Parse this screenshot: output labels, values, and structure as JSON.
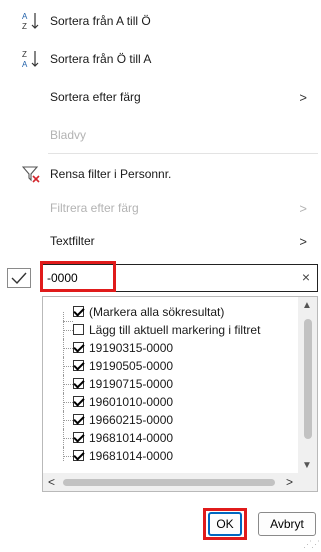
{
  "menu": {
    "sort_asc": "Sortera från A till Ö",
    "sort_desc": "Sortera från Ö till A",
    "sort_by_color": "Sortera efter färg",
    "sheet_view": "Bladvy",
    "clear_filter": "Rensa filter i Personnr.",
    "filter_by_color": "Filtrera efter färg",
    "text_filter": "Textfilter"
  },
  "search": {
    "value": "-0000",
    "clear_glyph": "×"
  },
  "list": {
    "select_all": "(Markera alla sökresultat)",
    "add_selection": "Lägg till aktuell markering i filtret",
    "values": [
      "19190315-0000",
      "19190505-0000",
      "19190715-0000",
      "19601010-0000",
      "19660215-0000",
      "19681014-0000"
    ],
    "partial_value": "19681014-0000"
  },
  "buttons": {
    "ok": "OK",
    "cancel": "Avbryt"
  },
  "colors": {
    "highlight": "#e01b1b",
    "focus": "#0067c0",
    "filter_x": "#d4262c"
  }
}
